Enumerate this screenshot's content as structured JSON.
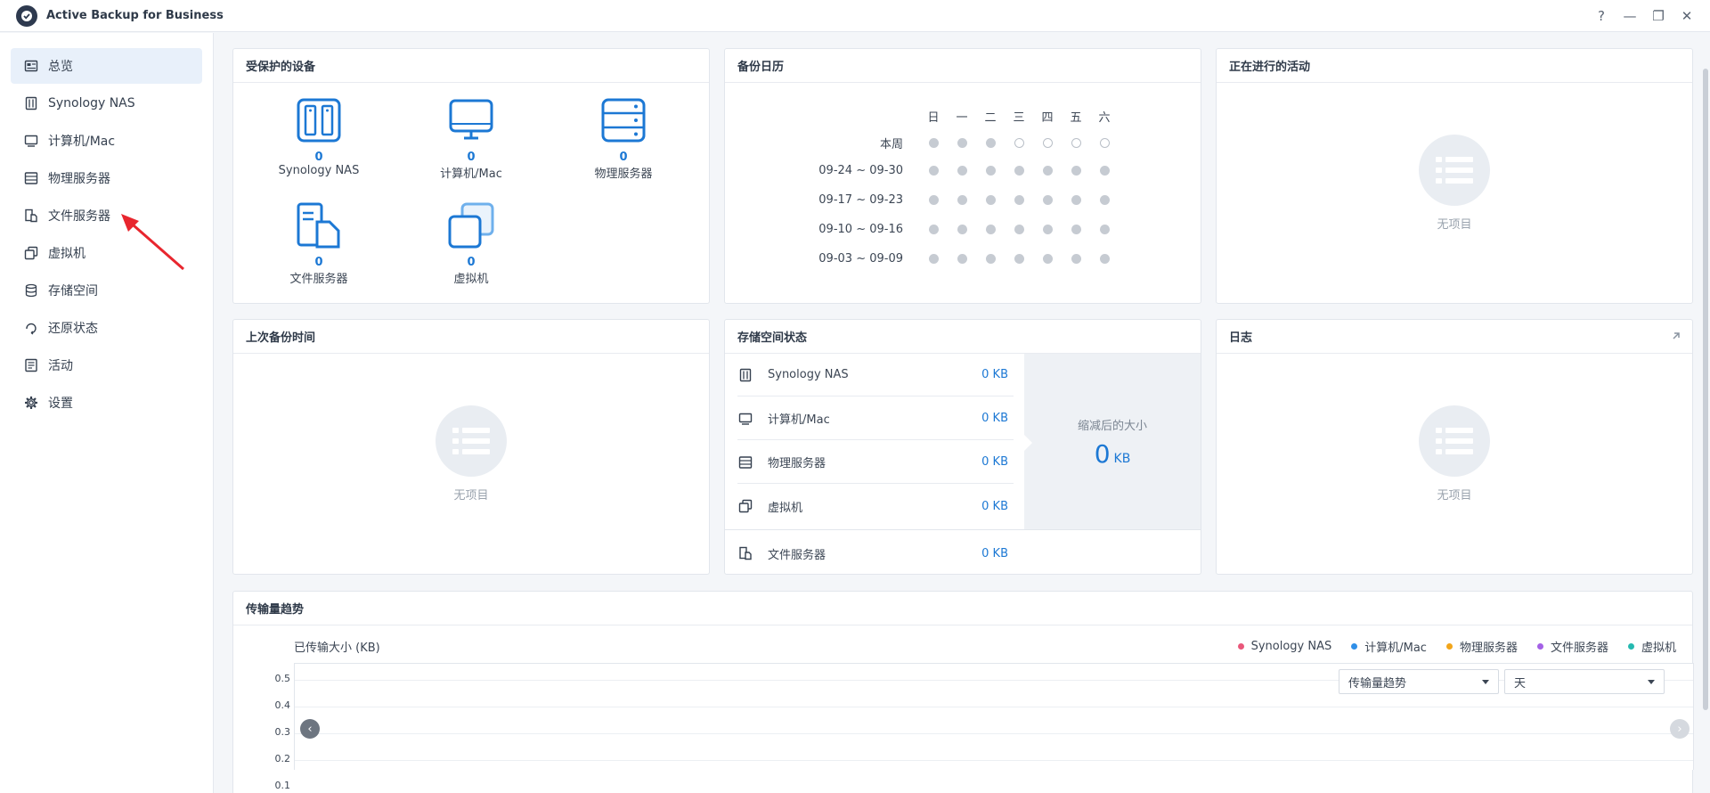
{
  "window": {
    "title": "Active Backup for Business",
    "controls": [
      "?",
      "—",
      "❐",
      "✕"
    ]
  },
  "sidebar": {
    "items": [
      {
        "label": "总览",
        "icon": "overview-icon",
        "active": true
      },
      {
        "label": "Synology NAS",
        "icon": "nas-icon"
      },
      {
        "label": "计算机/Mac",
        "icon": "computer-icon"
      },
      {
        "label": "物理服务器",
        "icon": "server-icon"
      },
      {
        "label": "文件服务器",
        "icon": "file-server-icon"
      },
      {
        "label": "虚拟机",
        "icon": "vm-icon"
      },
      {
        "label": "存储空间",
        "icon": "storage-icon"
      },
      {
        "label": "还原状态",
        "icon": "restore-icon"
      },
      {
        "label": "活动",
        "icon": "activity-icon"
      },
      {
        "label": "设置",
        "icon": "gear-icon"
      }
    ]
  },
  "protected_devices": {
    "title": "受保护的设备",
    "devices": [
      {
        "label": "Synology NAS",
        "count": "0"
      },
      {
        "label": "计算机/Mac",
        "count": "0"
      },
      {
        "label": "物理服务器",
        "count": "0"
      },
      {
        "label": "文件服务器",
        "count": "0"
      },
      {
        "label": "虚拟机",
        "count": "0"
      }
    ]
  },
  "calendar": {
    "title": "备份日历",
    "days": [
      "日",
      "一",
      "二",
      "三",
      "四",
      "五",
      "六"
    ],
    "weeks": [
      {
        "label": "本周",
        "filled": [
          true,
          true,
          true,
          false,
          false,
          false,
          false
        ]
      },
      {
        "label": "09-24 ~ 09-30",
        "filled": [
          true,
          true,
          true,
          true,
          true,
          true,
          true
        ]
      },
      {
        "label": "09-17 ~ 09-23",
        "filled": [
          true,
          true,
          true,
          true,
          true,
          true,
          true
        ]
      },
      {
        "label": "09-10 ~ 09-16",
        "filled": [
          true,
          true,
          true,
          true,
          true,
          true,
          true
        ]
      },
      {
        "label": "09-03 ~ 09-09",
        "filled": [
          true,
          true,
          true,
          true,
          true,
          true,
          true
        ]
      }
    ]
  },
  "activities": {
    "title": "正在进行的活动",
    "empty": "无项目"
  },
  "last_backup": {
    "title": "上次备份时间",
    "empty": "无项目"
  },
  "storage": {
    "title": "存储空间状态",
    "rows": [
      {
        "name": "Synology NAS",
        "value": "0 KB",
        "icon": "nas-icon"
      },
      {
        "name": "计算机/Mac",
        "value": "0 KB",
        "icon": "computer-icon"
      },
      {
        "name": "物理服务器",
        "value": "0 KB",
        "icon": "server-icon"
      },
      {
        "name": "虚拟机",
        "value": "0 KB",
        "icon": "vm-icon"
      },
      {
        "name": "文件服务器",
        "value": "0 KB",
        "icon": "file-server-icon"
      }
    ],
    "reduced_caption": "缩减后的大小",
    "reduced_value": "0",
    "reduced_unit": "KB"
  },
  "log": {
    "title": "日志",
    "empty": "无项目"
  },
  "trend": {
    "title": "传输量趋势",
    "y_title": "已传输大小 (KB)",
    "y_ticks": [
      "0.5",
      "0.4",
      "0.3",
      "0.2",
      "0.1"
    ],
    "legend": [
      {
        "name": "Synology NAS",
        "color": "#e9577a"
      },
      {
        "name": "计算机/Mac",
        "color": "#2f8fe8"
      },
      {
        "name": "物理服务器",
        "color": "#f2a51a"
      },
      {
        "name": "文件服务器",
        "color": "#a461e6"
      },
      {
        "name": "虚拟机",
        "color": "#25b9b0"
      }
    ],
    "select_metric": "传输量趋势",
    "select_period": "天"
  }
}
